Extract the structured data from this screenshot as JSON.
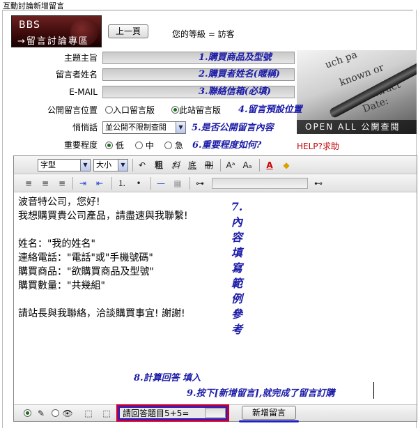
{
  "window": {
    "title": "互動討論新增留言"
  },
  "logo": {
    "line1": "BBS",
    "line2": "→留言討論專區"
  },
  "header": {
    "prev_button": "上一頁",
    "level_text": "您的等級 = 訪客"
  },
  "form": {
    "rows": [
      {
        "label": "主題主旨",
        "note": "1.購買商品及型號"
      },
      {
        "label": "留言者姓名",
        "note": "2.購買者姓名(暱稱)"
      },
      {
        "label": "E-MAIL",
        "note": "3.聯絡信箱(必填)"
      }
    ],
    "position": {
      "label": "公開留言位置",
      "option1": "入口留言版",
      "option2": "此站留言版",
      "note": "4.留言預設位置",
      "selected": "此站留言版"
    },
    "whisper": {
      "label": "悄悄話",
      "value": "並公開不限制查閱",
      "note": "5.是否公開留言內容"
    },
    "importance": {
      "label": "重要程度",
      "option1": "低",
      "option2": "中",
      "option3": "急",
      "note": "6.重要程度如何?",
      "selected": "低"
    },
    "help": "HELP?求助"
  },
  "photo": {
    "text1": "uch pa",
    "text2": "known or",
    "text3": "Contract Date:",
    "bar": "OPEN ALL 公開查閱"
  },
  "toolbar": {
    "font_select": "字型",
    "size_select": "大小"
  },
  "editor": {
    "content": "波音特公司，您好!\n我想購買貴公司產品，請盡速與我聯繫!\n\n姓名：\"我的姓名\"\n連絡電話：\"電話\"或\"手機號碼\"\n購買商品：\"欲購買商品及型號\"\n購買數量：\"共幾組\"\n\n請站長與我聯絡，洽談購買事宜! 謝謝!",
    "vertical_note": "7.內容填寫範例 參考"
  },
  "notes": {
    "note8": "8.計算回答 填入",
    "note9": "9.按下[新增留言],就完成了留言訂購"
  },
  "captcha": {
    "question": "請回答題目5+5="
  },
  "submit_button": "新增留言",
  "colors": {
    "note": "#1b1ba8",
    "help": "#c00000",
    "highlight_red": "#c0003a",
    "highlight_blue": "#2020c0"
  }
}
